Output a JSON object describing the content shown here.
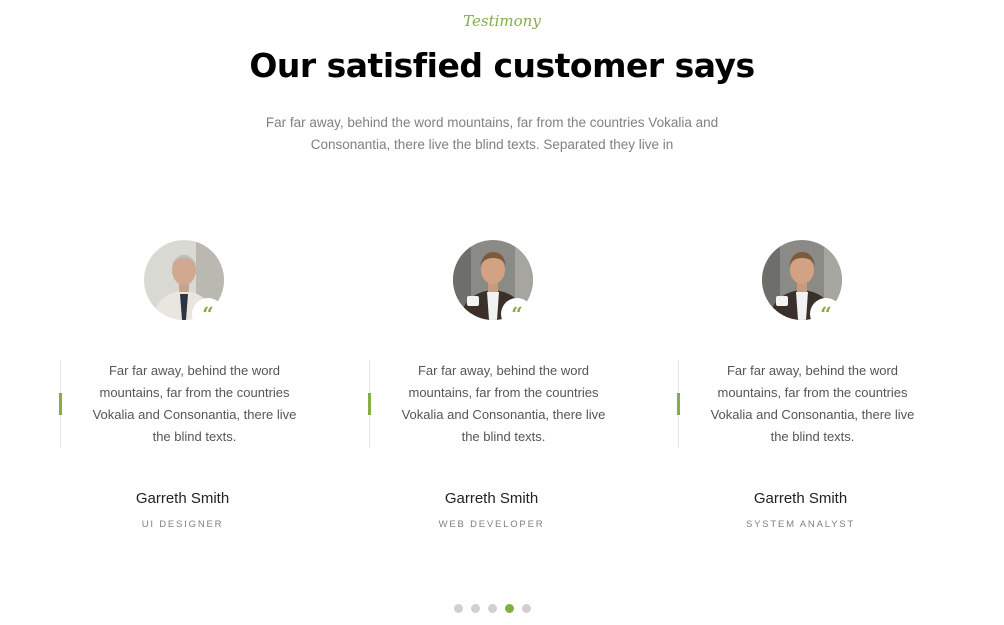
{
  "section": {
    "subheading": "Testimony",
    "heading": "Our satisfied customer says",
    "intro": "Far far away, behind the word mountains, far from the countries Vokalia and Consonantia, there live the blind texts. Separated they live in"
  },
  "quote_icon": "quote-icon",
  "accent_color": "#82ae46",
  "testimonials": [
    {
      "quote": "Far far away, behind the word mountains, far from the countries Vokalia and Consonantia, there live the blind texts.",
      "name": "Garreth Smith",
      "position": "UI DESIGNER"
    },
    {
      "quote": "Far far away, behind the word mountains, far from the countries Vokalia and Consonantia, there live the blind texts.",
      "name": "Garreth Smith",
      "position": "WEB DEVELOPER"
    },
    {
      "quote": "Far far away, behind the word mountains, far from the countries Vokalia and Consonantia, there live the blind texts.",
      "name": "Garreth Smith",
      "position": "SYSTEM ANALYST"
    }
  ],
  "carousel": {
    "total": 5,
    "active_index": 3
  }
}
